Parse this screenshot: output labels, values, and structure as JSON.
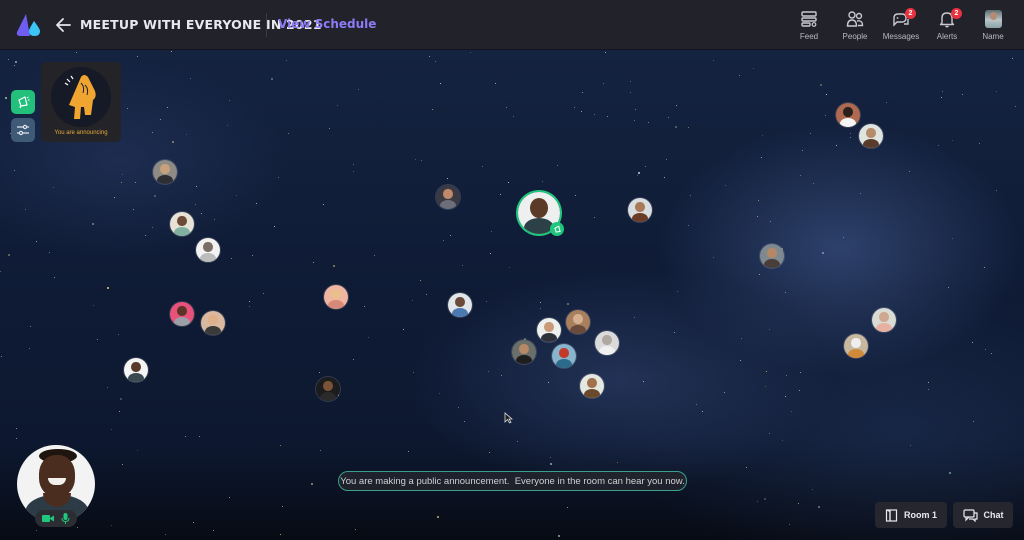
{
  "header": {
    "title": "MEETUP WITH EVERYONE IN 2021",
    "view_schedule": "View Schedule",
    "nav": [
      {
        "id": "feed",
        "label": "Feed",
        "icon": "feed-icon"
      },
      {
        "id": "people",
        "label": "People",
        "icon": "people-icon"
      },
      {
        "id": "messages",
        "label": "Messages",
        "icon": "messages-icon",
        "badge": "2"
      },
      {
        "id": "alerts",
        "label": "Alerts",
        "icon": "bell-icon",
        "badge": "2"
      },
      {
        "id": "name",
        "label": "Name",
        "icon": "user-avatar"
      }
    ]
  },
  "sidebar": {
    "announce_button": "announce-icon",
    "settings_button": "sliders-icon"
  },
  "announcement_card": {
    "label": "You are announcing"
  },
  "toast": {
    "message": "You are making a public announcement.  Everyone in the room can hear you now."
  },
  "bottom": {
    "room_label": "Room 1",
    "chat_label": "Chat"
  },
  "self_view": {
    "camera": "on",
    "mic": "on"
  },
  "colors": {
    "accent": "#8b7cf6",
    "speaker_ring": "#1fc77c",
    "badge": "#e9323e",
    "announce_orange": "#e6a93a"
  },
  "participants_count": 27
}
